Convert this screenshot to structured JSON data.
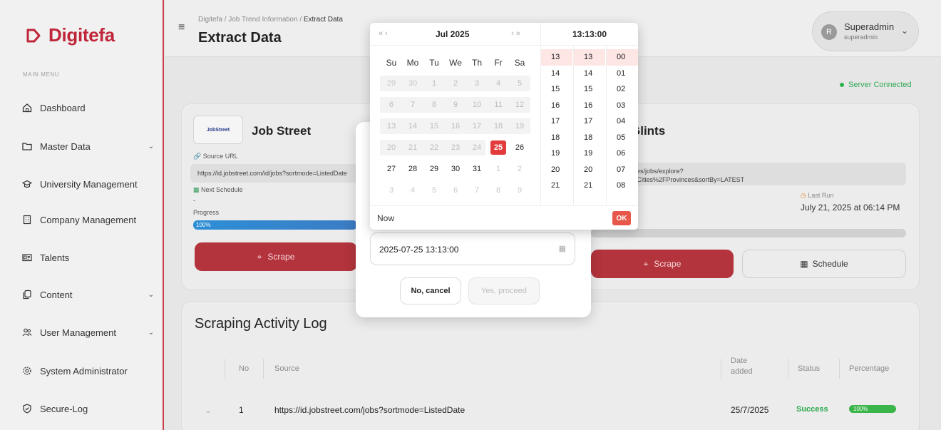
{
  "brand": {
    "name": "Digitefa",
    "accent": "#c0263a"
  },
  "sidebar": {
    "heading": "MAIN MENU",
    "items": [
      {
        "label": "Dashboard",
        "icon": "home-icon"
      },
      {
        "label": "Master Data",
        "icon": "folder-icon",
        "has_children": true
      },
      {
        "label": "University Management",
        "icon": "graduation-cap-icon"
      },
      {
        "label": "Company Management",
        "icon": "building-icon"
      },
      {
        "label": "Talents",
        "icon": "id-card-icon"
      },
      {
        "label": "Content",
        "icon": "copy-icon",
        "has_children": true
      },
      {
        "label": "User Management",
        "icon": "users-icon",
        "has_children": true
      },
      {
        "label": "System Administrator",
        "icon": "gear-icon"
      },
      {
        "label": "Secure-Log",
        "icon": "shield-check-icon"
      }
    ]
  },
  "header": {
    "breadcrumb": [
      "Digitefa",
      "Job Trend Information",
      "Extract Data"
    ],
    "title": "Extract Data",
    "user": {
      "name": "Superadmin",
      "role": "superadmin",
      "initial": "R"
    }
  },
  "server_status": "Server Connected",
  "sources": [
    {
      "name": "Job Street",
      "logo_text": "JobStreet",
      "source_url_label": "Source URL",
      "url": "https://id.jobstreet.com/id/jobs?sortmode=ListedDate",
      "schedule_label": "Next Schedule",
      "schedule_value": "-",
      "progress_label": "Progress",
      "progress": "100%",
      "scrape_label": "Scrape"
    },
    {
      "name": "Glints",
      "url": "/id/opportunities/jobs/explore?",
      "url_line2": "onName=All+Cities%2FProvinces&sortBy=LATEST",
      "last_run_label": "Last Run",
      "last_run": "July 21, 2025 at 06:14 PM",
      "scrape_label": "Scrape",
      "schedule_btn": "Schedule"
    }
  ],
  "log": {
    "title": "Scraping Activity Log",
    "columns": [
      "No",
      "Source",
      "Date added",
      "Status",
      "Percentage"
    ],
    "rows": [
      {
        "no": "1",
        "source": "https://id.jobstreet.com/jobs?sortmode=ListedDate",
        "date": "25/7/2025",
        "status": "Success",
        "percentage": "100%"
      }
    ]
  },
  "modal": {
    "datetime_value": "2025-07-25 13:13:00",
    "cancel_label": "No, cancel",
    "proceed_label": "Yes, proceed"
  },
  "picker": {
    "nav_prev": "« ‹",
    "nav_next": "› »",
    "month_year": "Jul 2025",
    "time_header": "13:13:00",
    "weekdays": [
      "Su",
      "Mo",
      "Tu",
      "We",
      "Th",
      "Fr",
      "Sa"
    ],
    "weeks": [
      [
        "29",
        "30",
        "1",
        "2",
        "3",
        "4",
        "5"
      ],
      [
        "6",
        "7",
        "8",
        "9",
        "10",
        "11",
        "12"
      ],
      [
        "13",
        "14",
        "15",
        "16",
        "17",
        "18",
        "19"
      ],
      [
        "20",
        "21",
        "22",
        "23",
        "24",
        "25",
        "26"
      ],
      [
        "27",
        "28",
        "29",
        "30",
        "31",
        "1",
        "2"
      ],
      [
        "3",
        "4",
        "5",
        "6",
        "7",
        "8",
        "9"
      ]
    ],
    "selected_day": "25",
    "hours": [
      "13",
      "14",
      "15",
      "16",
      "17",
      "18",
      "19",
      "20",
      "21"
    ],
    "minutes": [
      "13",
      "14",
      "15",
      "16",
      "17",
      "18",
      "19",
      "20",
      "21"
    ],
    "seconds": [
      "00",
      "01",
      "02",
      "03",
      "04",
      "05",
      "06",
      "07",
      "08"
    ],
    "now_label": "Now",
    "ok_label": "OK"
  }
}
